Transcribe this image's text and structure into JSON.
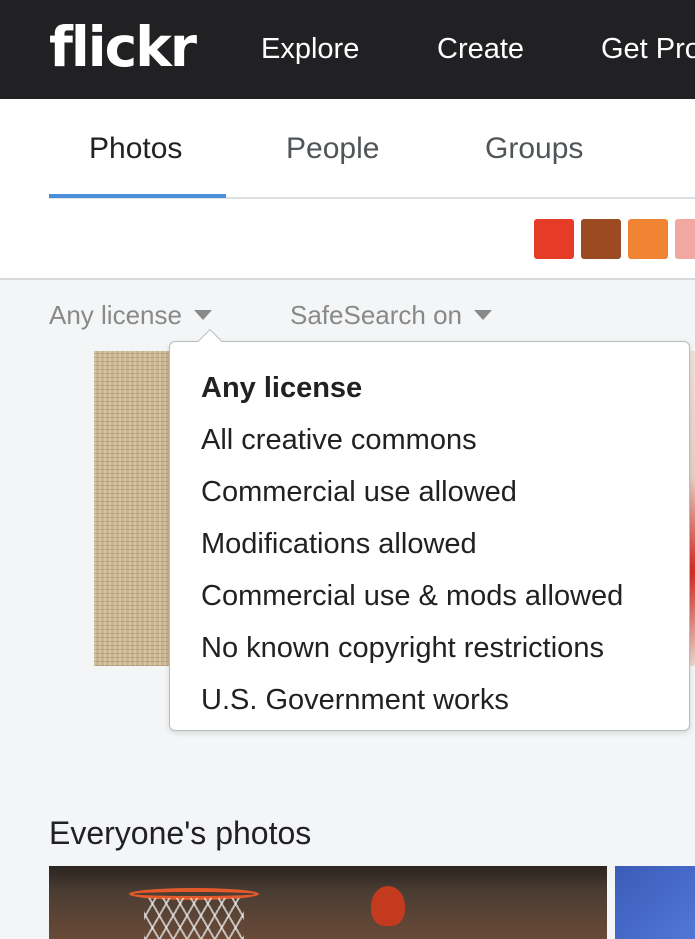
{
  "header": {
    "logo": "flickr",
    "nav": [
      "Explore",
      "Create",
      "Get Pro"
    ]
  },
  "tabs": {
    "items": [
      "Photos",
      "People",
      "Groups"
    ],
    "active": "Photos"
  },
  "color_swatches": [
    "#e63b26",
    "#9c4a22",
    "#f08432",
    "#f0a8a0"
  ],
  "filters": {
    "license_label": "Any license",
    "safesearch_label": "SafeSearch on"
  },
  "license_menu": {
    "selected": "Any license",
    "options": [
      "Any license",
      "All creative commons",
      "Commercial use allowed",
      "Modifications allowed",
      "Commercial use & mods allowed",
      "No known copyright restrictions",
      "U.S. Government works"
    ]
  },
  "section": {
    "title": "Everyone's photos"
  }
}
